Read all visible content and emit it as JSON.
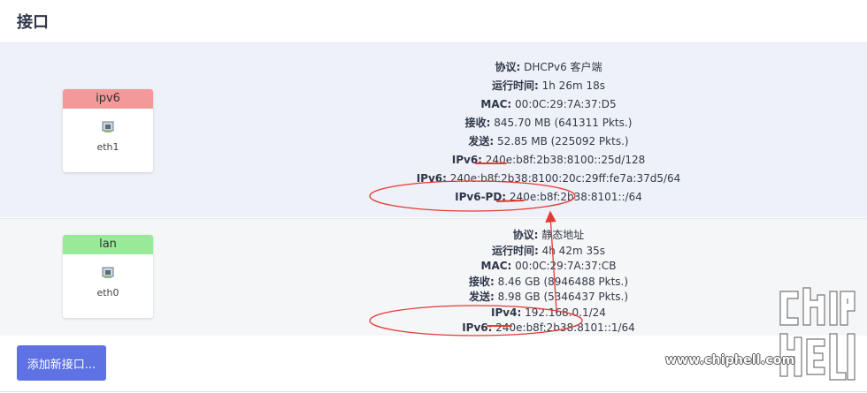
{
  "page": {
    "title": "接口"
  },
  "interfaces": [
    {
      "name": "ipv6",
      "device": "eth1",
      "lines": [
        {
          "label": "协议:",
          "value": " DHCPv6 客户端"
        },
        {
          "label": "运行时间:",
          "value": " 1h 26m 18s"
        },
        {
          "label": "MAC:",
          "value": " 00:0C:29:7A:37:D5"
        },
        {
          "label": "接收:",
          "value": " 845.70 MB (641311 Pkts.)"
        },
        {
          "label": "发送:",
          "value": " 52.85 MB (225092 Pkts.)"
        },
        {
          "label": "IPv6:",
          "value": " 240e:b8f:2b38:8100::25d/128"
        },
        {
          "label": "IPv6:",
          "value": " 240e:b8f:2b38:8100:20c:29ff:fe7a:37d5/64"
        },
        {
          "label": "IPv6-PD:",
          "value": " 240e:b8f:2b38:8101::/64"
        }
      ]
    },
    {
      "name": "lan",
      "device": "eth0",
      "lines": [
        {
          "label": "协议:",
          "value": " 静态地址"
        },
        {
          "label": "运行时间:",
          "value": " 4h 42m 35s"
        },
        {
          "label": "MAC:",
          "value": " 00:0C:29:7A:37:CB"
        },
        {
          "label": "接收:",
          "value": " 8.46 GB (8946488 Pkts.)"
        },
        {
          "label": "发送:",
          "value": " 8.98 GB (5346437 Pkts.)"
        },
        {
          "label": "IPv4:",
          "value": " 192.168.0.1/24"
        },
        {
          "label": "IPv6:",
          "value": " 240e:b8f:2b38:8101::1/64"
        }
      ]
    }
  ],
  "actions": {
    "add_interface": "添加新接口..."
  },
  "watermark": {
    "site": "www.chiphell.com",
    "logo_text": "chip hell"
  },
  "colors": {
    "ipv6_header": "#f39999",
    "lan_header": "#98ea98",
    "button": "#5e72e4",
    "annotation": "#e53935"
  }
}
